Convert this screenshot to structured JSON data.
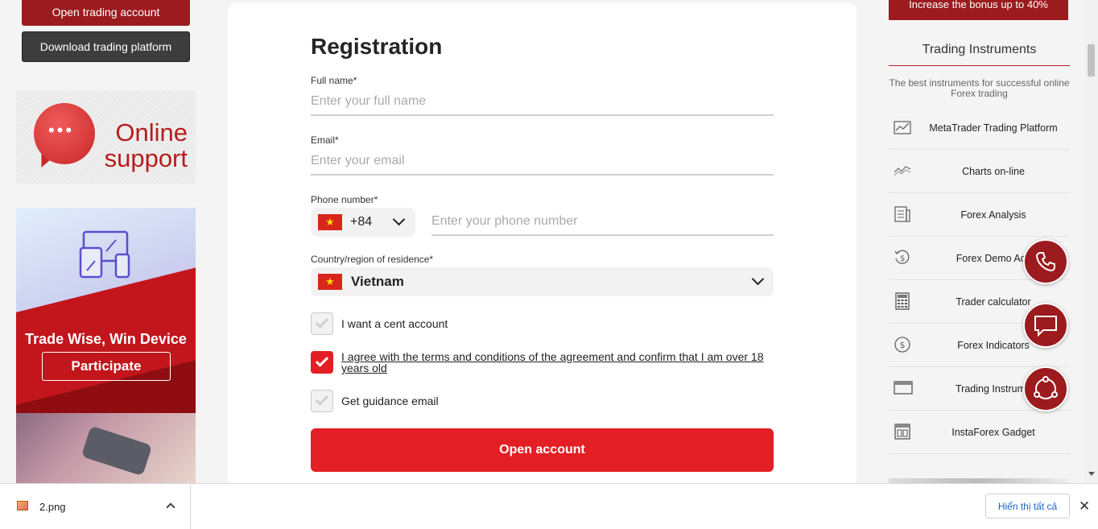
{
  "left_sidebar": {
    "open_account_label": "Open trading account",
    "download_platform_label": "Download trading platform",
    "support": {
      "line1": "Online",
      "line2": "support"
    },
    "promo": {
      "title": "Trade Wise, Win Device",
      "button_label": "Participate"
    }
  },
  "form": {
    "title": "Registration",
    "full_name": {
      "label": "Full name*",
      "placeholder": "Enter your full name"
    },
    "email": {
      "label": "Email*",
      "placeholder": "Enter your email"
    },
    "phone": {
      "label": "Phone number*",
      "code": "+84",
      "placeholder": "Enter your phone number"
    },
    "country": {
      "label": "Country/region of residence*",
      "value": "Vietnam"
    },
    "checkboxes": [
      {
        "label": "I want a cent account",
        "checked": false
      },
      {
        "label": "I agree with the terms and conditions of the agreement and confirm that I am over 18 years old",
        "checked": true
      },
      {
        "label": "Get guidance email",
        "checked": false
      }
    ],
    "submit_label": "Open account"
  },
  "right_sidebar": {
    "bonus_text": "Increase the bonus up to 40%",
    "title": "Trading Instruments",
    "subtitle": "The best instruments for successful online Forex trading",
    "items": [
      {
        "label": "MetaTrader Trading Platform",
        "icon": "chart-icon"
      },
      {
        "label": "Charts on-line",
        "icon": "line-chart-icon"
      },
      {
        "label": "Forex Analysis",
        "icon": "newspaper-icon"
      },
      {
        "label": "Forex Demo Acc",
        "icon": "dollar-history-icon"
      },
      {
        "label": "Trader calculator",
        "icon": "calculator-icon"
      },
      {
        "label": "Forex Indicators",
        "icon": "dollar-circle-icon"
      },
      {
        "label": "Trading Instrume",
        "icon": "window-icon"
      },
      {
        "label": "InstaForex Gadget",
        "icon": "gadget-icon"
      }
    ]
  },
  "download_bar": {
    "file_name": "2.png",
    "show_all_label": "Hiển thị tất cả"
  },
  "colors": {
    "brand_red": "#e31e24",
    "dark_red": "#9b1b1e"
  }
}
